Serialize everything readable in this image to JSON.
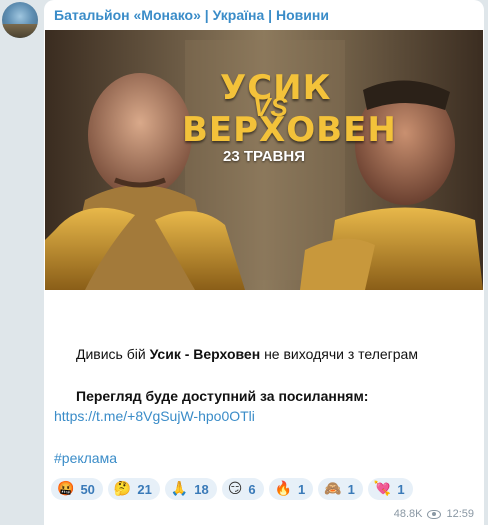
{
  "channel": {
    "title": "Батальйон «Монако» | Україна | Новини",
    "avatar_icon": "channel-avatar"
  },
  "media": {
    "title_line1": "УСИК",
    "vs": "VS",
    "title_line2": "ВЕРХОВЕН",
    "date": "23 ТРАВНЯ",
    "accent": "#f3c23a"
  },
  "message": {
    "line1_pre": "Дивись бій ",
    "line1_bold": "Усик - Верховен",
    "line1_post": " не виходячи з телеграм",
    "line2": "Перегляд буде доступний за посиланням:",
    "link": "https://t.me/+8VgSujW-hpo0OTli",
    "hashtag": "#реклама"
  },
  "reactions": [
    {
      "emoji": "🤬",
      "icon": "angry-face-icon",
      "count": "50"
    },
    {
      "emoji": "🤔",
      "icon": "thinking-face-icon",
      "count": "21"
    },
    {
      "emoji": "🙏",
      "icon": "folded-hands-icon",
      "count": "18"
    },
    {
      "emoji": "😏",
      "icon": "smirk-face-icon",
      "count": "6"
    },
    {
      "emoji": "🔥",
      "icon": "fire-icon",
      "count": "1"
    },
    {
      "emoji": "🙈",
      "icon": "see-no-evil-monkey-icon",
      "count": "1"
    },
    {
      "emoji": "💘",
      "icon": "heart-arrow-icon",
      "count": "1"
    }
  ],
  "meta": {
    "views": "48.8K",
    "time": "12:59"
  }
}
